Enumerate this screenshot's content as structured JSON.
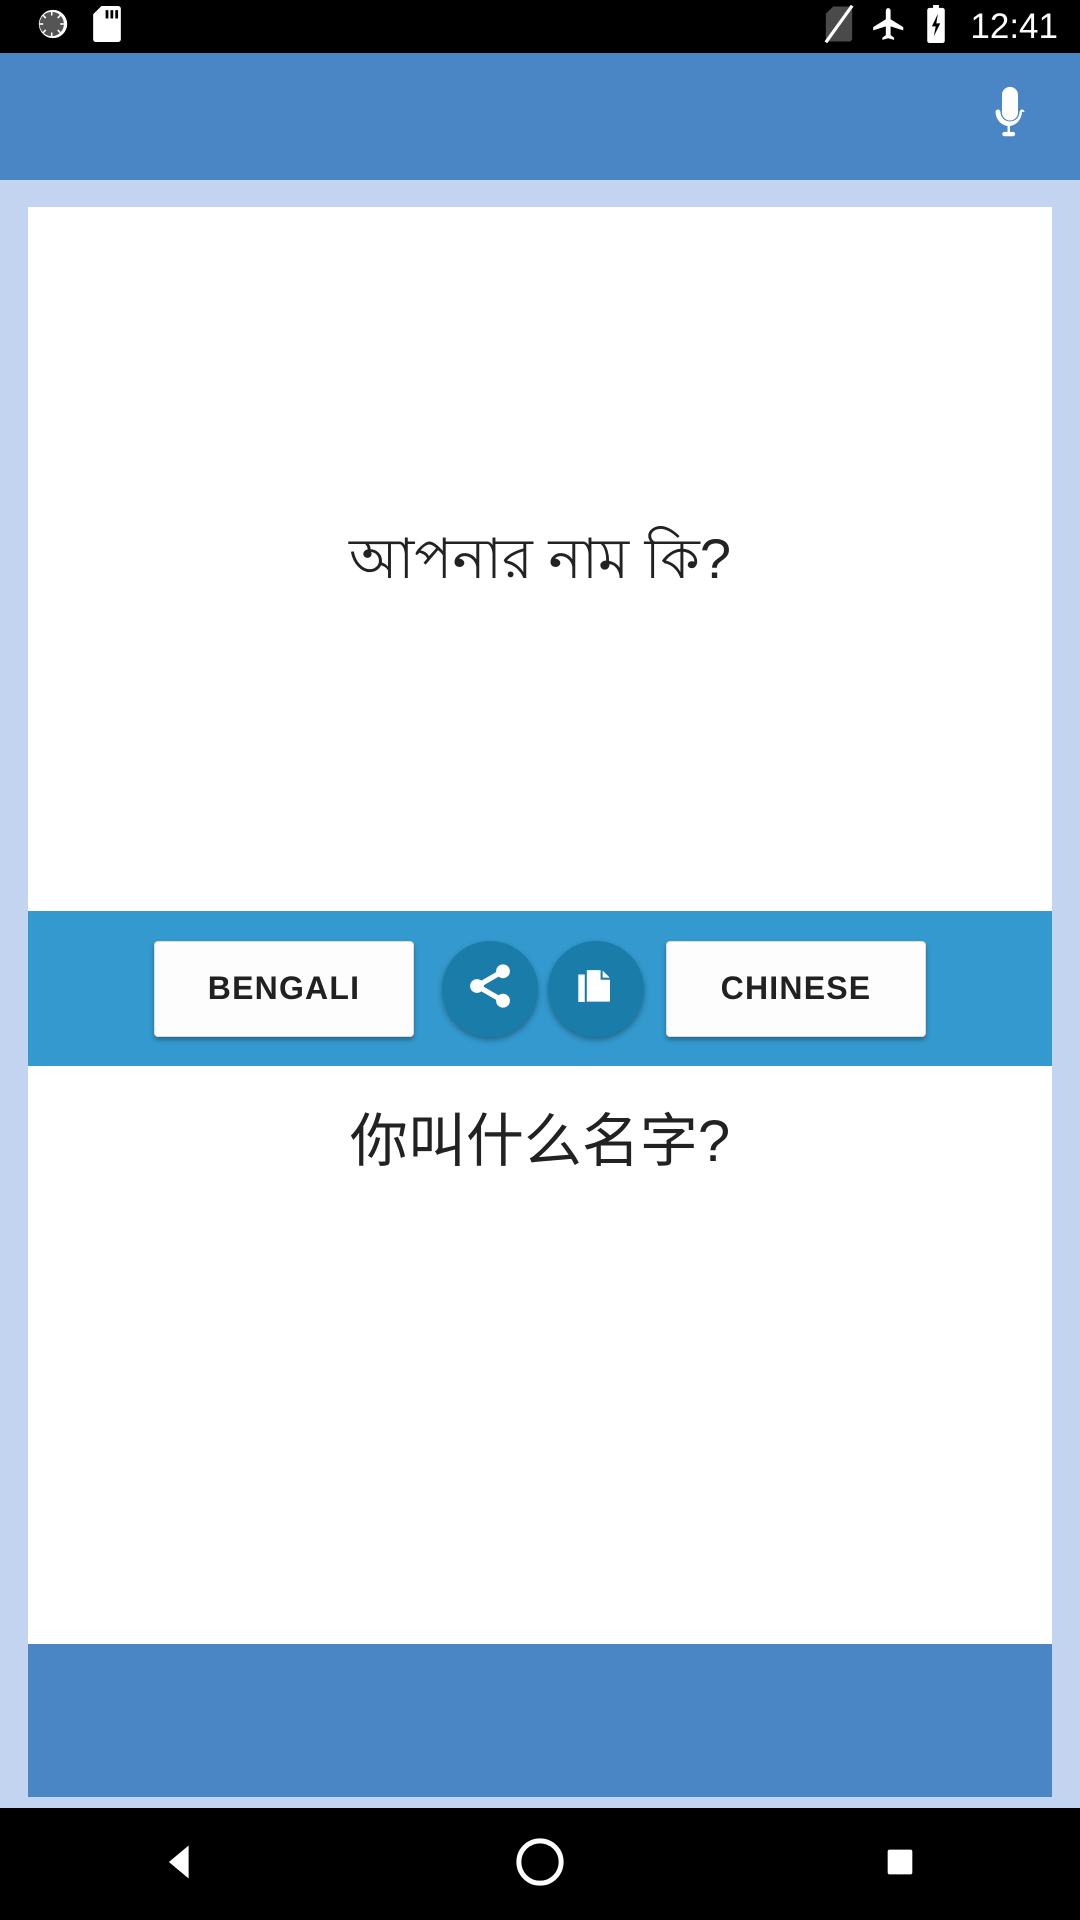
{
  "status_bar": {
    "left_icons": [
      {
        "name": "sync-loading-icon",
        "label": "sync"
      },
      {
        "name": "sd-card-icon",
        "label": "sd-card"
      }
    ],
    "right_icons": [
      {
        "name": "no-sim-icon",
        "label": "no-sim"
      },
      {
        "name": "airplane-mode-icon",
        "label": "airplane-mode"
      },
      {
        "name": "battery-charging-icon",
        "label": "battery-charging"
      }
    ],
    "clock": "12:41",
    "background": "#000000",
    "foreground": "#ffffff"
  },
  "app_bar": {
    "title": "",
    "background": "#4a86c5",
    "mic_icon": "microphone-icon"
  },
  "source": {
    "text": "আপনার নাম কি?",
    "language": "BENGALI"
  },
  "target": {
    "text": "你叫什么名字?",
    "language": "CHINESE"
  },
  "action_bar": {
    "background": "#3399ce",
    "share_icon": "share-icon",
    "copy_icon": "copy-icon",
    "source_language_label": "BENGALI",
    "target_language_label": "CHINESE"
  },
  "bottom_panel": {
    "background": "#4a86c5",
    "text": ""
  },
  "nav_bar": {
    "back": "back-triangle-icon",
    "home": "home-circle-icon",
    "recents": "recents-square-icon",
    "background": "#000000"
  },
  "theme": {
    "page_background": "#c3d4f0",
    "card_background": "#ffffff",
    "accent": "#4a86c5",
    "accent_bright": "#3399ce",
    "round_button": "#1a7ca8",
    "text_color": "#222222"
  }
}
